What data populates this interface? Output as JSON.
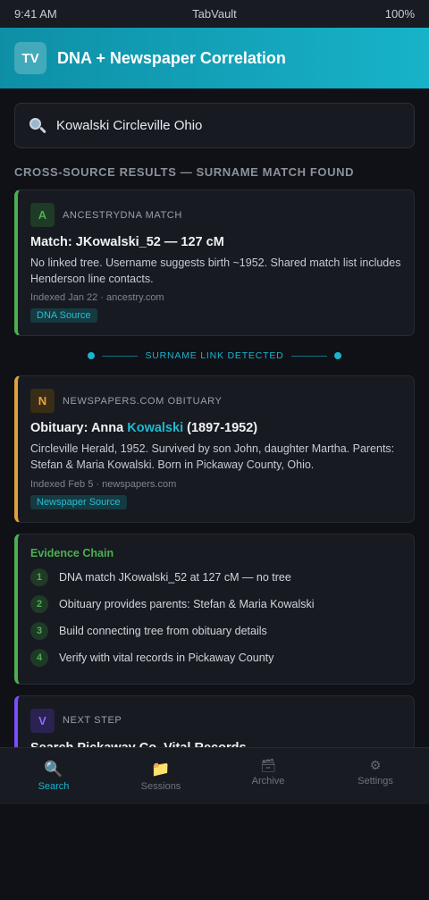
{
  "status": {
    "time": "9:41 AM",
    "app": "TabVault",
    "battery": "100%"
  },
  "header": {
    "logo": "TV",
    "title": "DNA + Newspaper Correlation"
  },
  "search": {
    "value": "Kowalski Circleville Ohio",
    "icon": "search-icon"
  },
  "section_heading": "Cross-Source Results — Surname Match Found",
  "cards": {
    "dna": {
      "badge": "A",
      "source": "AncestryDNA Match",
      "title": "Match: JKowalski_52 — 127 cM",
      "body": "No linked tree. Username suggests birth ~1952. Shared match list includes Henderson line contacts.",
      "meta": "Indexed Jan 22 · ancestry.com",
      "tag": "DNA Source",
      "accent": "#4caf50"
    },
    "link": "Surname link detected",
    "obituary": {
      "badge": "N",
      "source": "Newspapers.com Obituary",
      "title_prefix": "Obituary: Anna ",
      "title_highlight": "Kowalski",
      "title_suffix": " (1897-1952)",
      "body": "Circleville Herald, 1952. Survived by son John, daughter Martha. Parents: Stefan & Maria Kowalski. Born in Pickaway County, Ohio.",
      "meta": "Indexed Feb 5 · newspapers.com",
      "tag": "Newspaper Source",
      "accent": "#e0a03a"
    },
    "evidence": {
      "title": "Evidence Chain",
      "steps": [
        {
          "num": "1",
          "text": "DNA match JKowalski_52 at 127 cM — no tree"
        },
        {
          "num": "2",
          "text": "Obituary provides parents: Stefan & Maria Kowalski"
        },
        {
          "num": "3",
          "text": "Build connecting tree from obituary details"
        },
        {
          "num": "4",
          "text": "Verify with vital records in Pickaway County"
        }
      ]
    },
    "next": {
      "badge": "V",
      "source": "Next Step",
      "title": "Search Pickaway Co. Vital Records",
      "accent": "#7c4dff"
    }
  },
  "tabs": [
    {
      "label": "Search",
      "icon": "🔍",
      "active": true
    },
    {
      "label": "Sessions",
      "icon": "📁"
    },
    {
      "label": "Archive",
      "icon": "🗃"
    },
    {
      "label": "Settings",
      "icon": "⚙"
    }
  ],
  "colors": {
    "accent": "#19b4cc",
    "background": "#0f1117",
    "card": "#171a21"
  }
}
